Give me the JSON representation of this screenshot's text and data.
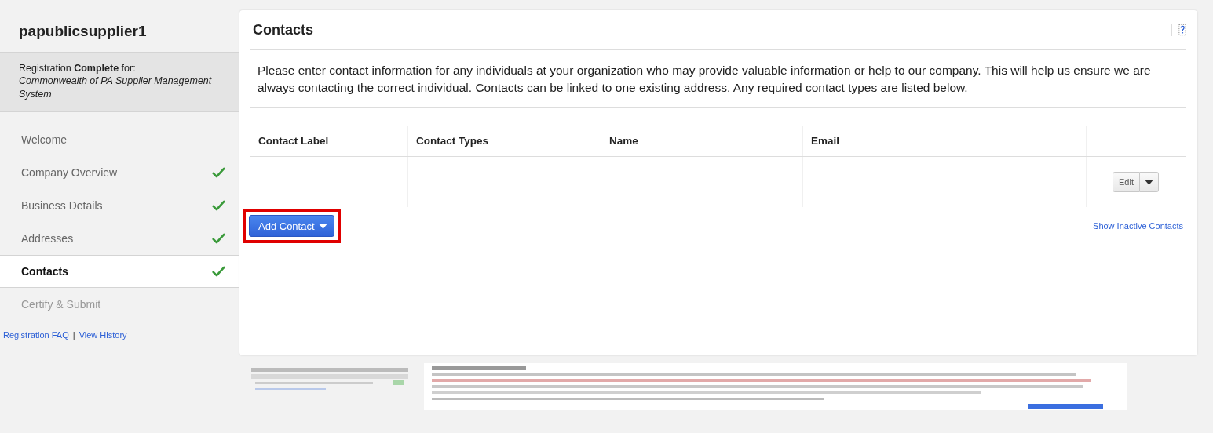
{
  "sidebar": {
    "title": "papublicsupplier1",
    "registration_text": "Registration **Complete** for:",
    "organization": "Commonwealth of PA Supplier Management System",
    "steps": [
      {
        "label": "Welcome",
        "complete": false,
        "selected": false,
        "disabled": false
      },
      {
        "label": "Company Overview",
        "complete": true,
        "selected": false,
        "disabled": false
      },
      {
        "label": "Business Details",
        "complete": true,
        "selected": false,
        "disabled": false
      },
      {
        "label": "Addresses",
        "complete": true,
        "selected": false,
        "disabled": false
      },
      {
        "label": "Contacts",
        "complete": true,
        "selected": true,
        "disabled": false
      },
      {
        "label": "Certify & Submit",
        "complete": false,
        "selected": false,
        "disabled": true
      }
    ],
    "footer_links": [
      "Registration FAQ",
      "View History"
    ],
    "link_separator": "|"
  },
  "main": {
    "title": "Contacts",
    "description": "Please enter contact information for any individuals at your organization who may provide valuable information or help to our company. This will help us ensure we are always contacting the correct individual. Contacts can be linked to one existing address. Any required contact types are listed below.",
    "table": {
      "columns": [
        "Contact Label",
        "Contact Types",
        "Name",
        "Email"
      ],
      "rows": [
        {
          "action": "Edit"
        }
      ]
    },
    "add_button": {
      "label": "Add Contact",
      "highlighted": true
    },
    "inactive_link": "Show Inactive Contacts"
  }
}
